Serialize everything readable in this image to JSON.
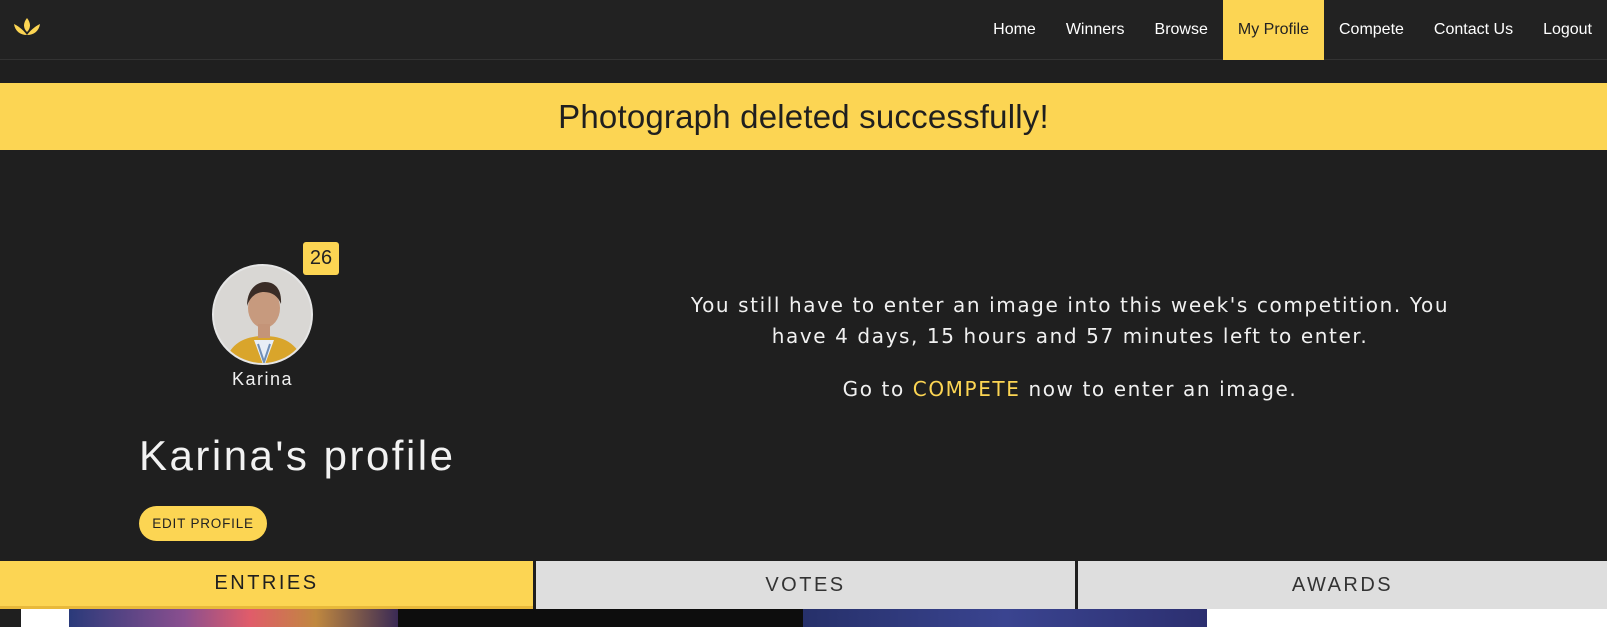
{
  "nav": {
    "items": [
      "Home",
      "Winners",
      "Browse",
      "My Profile",
      "Compete",
      "Contact Us",
      "Logout"
    ],
    "active": "My Profile"
  },
  "banner": {
    "message": "Photograph deleted successfully!"
  },
  "profile": {
    "badge_count": "26",
    "username": "Karina",
    "title": "Karina's profile",
    "edit_label": "EDIT PROFILE"
  },
  "notice": {
    "line1": "You still have to enter an image into this week's competition. You have 4 days, 15 hours and 57 minutes left to enter.",
    "go_prefix": "Go to ",
    "compete_link": "COMPETE",
    "go_suffix": " now to enter an image."
  },
  "tabs": {
    "entries": "ENTRIES",
    "votes": "VOTES",
    "awards": "AWARDS"
  },
  "colors": {
    "accent": "#fcd553",
    "background": "#1f1f1f",
    "navbar": "#222222",
    "tab_inactive": "#dedede"
  },
  "icons": {
    "logo": "lotus-logo-icon"
  }
}
